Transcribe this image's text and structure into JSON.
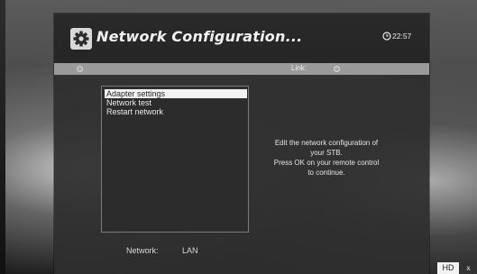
{
  "header": {
    "title": "Network Configuration...",
    "icon": "gear-icon",
    "clock_icon": "clock-icon",
    "time": "22:57"
  },
  "status_bar": {
    "link_label": "Link:"
  },
  "menu": {
    "items": [
      {
        "label": "Adapter settings",
        "selected": true
      },
      {
        "label": "Network test",
        "selected": false
      },
      {
        "label": "Restart network",
        "selected": false
      }
    ]
  },
  "help": {
    "lines": [
      "Edit the network configuration of",
      "your STB.",
      "Press OK on your remote control",
      "to continue."
    ]
  },
  "footer": {
    "network_label": "Network:",
    "network_value": "LAN"
  },
  "badges": {
    "hd": "HD",
    "x": "x"
  },
  "colors": {
    "panel": "#2e2e2e",
    "status_bar": "#9a9a9a",
    "selection": "#f3f3f3"
  }
}
